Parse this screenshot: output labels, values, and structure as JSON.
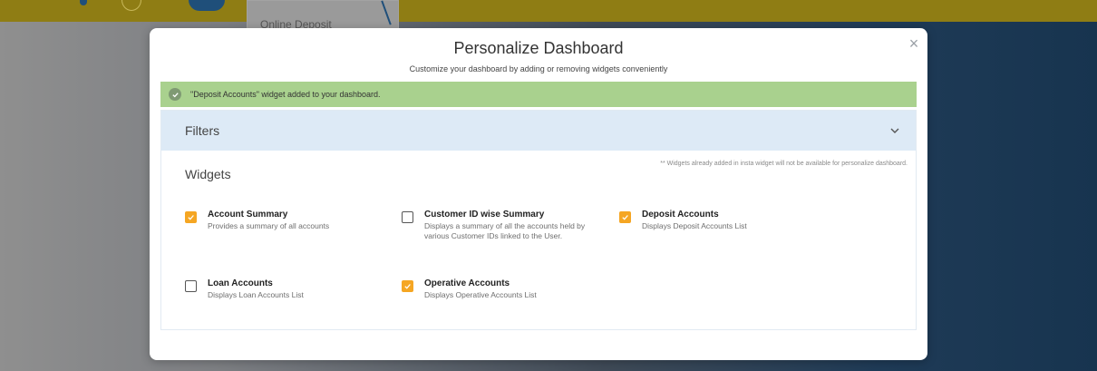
{
  "background": {
    "partial_tab_label": "Online Deposit"
  },
  "modal": {
    "title": "Personalize Dashboard",
    "subtitle": "Customize your dashboard by adding or removing widgets conveniently",
    "close_icon": "close-icon",
    "alert": {
      "text": "\"Deposit Accounts\" widget added to your dashboard.",
      "icon": "check-circle-icon",
      "color": "#a9d18e"
    },
    "filters": {
      "label": "Filters",
      "icon": "chevron-down-icon"
    },
    "widgets_section": {
      "title": "Widgets",
      "note": "** Widgets already added in insta widget will not be available for personalize dashboard."
    },
    "widgets": [
      {
        "name": "Account Summary",
        "desc": "Provides a summary of all accounts",
        "checked": true
      },
      {
        "name": "Customer ID wise Summary",
        "desc": "Displays a summary of all the accounts held by various Customer IDs linked to the User.",
        "checked": false
      },
      {
        "name": "Deposit Accounts",
        "desc": "Displays Deposit Accounts List",
        "checked": true
      },
      {
        "name": "Loan Accounts",
        "desc": "Displays Loan Accounts List",
        "checked": false
      },
      {
        "name": "Operative Accounts",
        "desc": "Displays Operative Accounts List",
        "checked": true
      }
    ],
    "accent_color": "#f5a623"
  }
}
